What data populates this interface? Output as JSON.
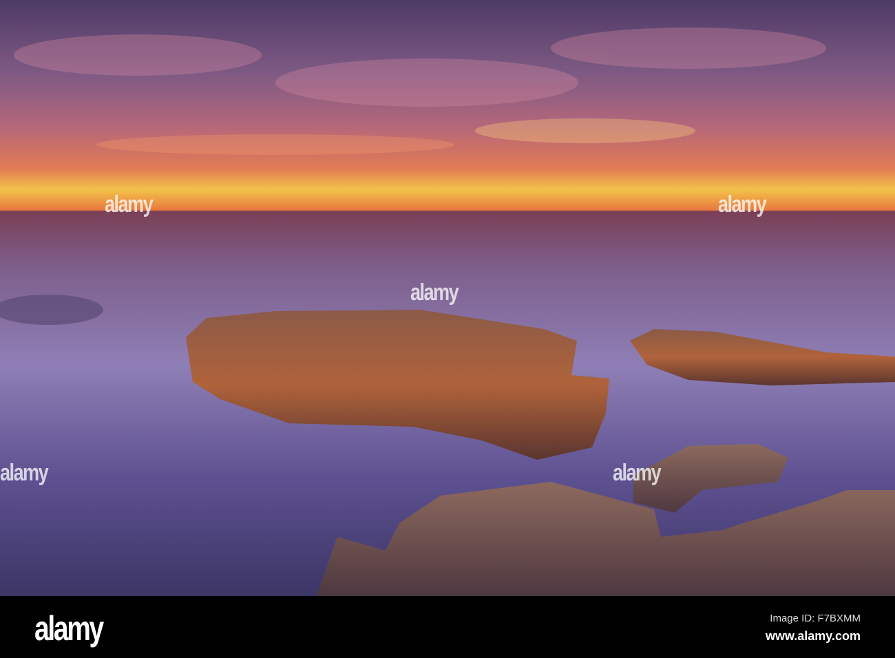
{
  "watermark": {
    "text": "alamy"
  },
  "footer": {
    "logo": "alamy",
    "image_id": "Image ID: F7BXMM",
    "url": "www.alamy.com"
  },
  "colors": {
    "sky_top": "#5a3f6e",
    "horizon": "#f5c44a",
    "sea": "#6a5a96",
    "rock": "#8a4a2a"
  }
}
